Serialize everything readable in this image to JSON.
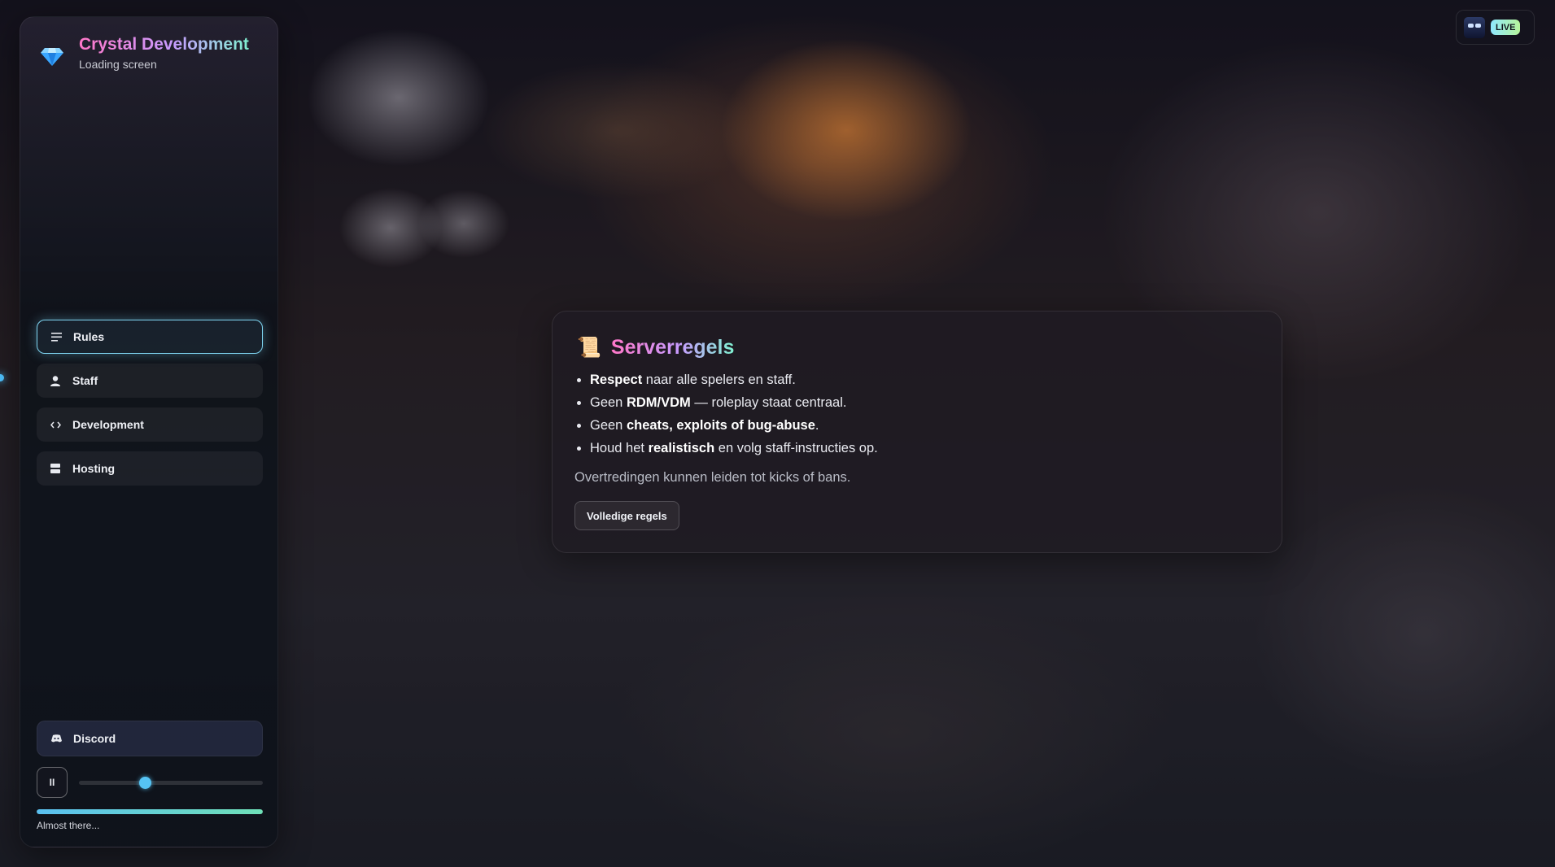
{
  "app": {
    "title": "Crystal Development",
    "subtitle": "Loading screen"
  },
  "sidebar": {
    "nav": [
      {
        "label": "Rules",
        "icon": "list-icon",
        "active": true
      },
      {
        "label": "Staff",
        "icon": "user-icon",
        "active": false
      },
      {
        "label": "Development",
        "icon": "code-icon",
        "active": false
      },
      {
        "label": "Hosting",
        "icon": "server-icon",
        "active": false
      }
    ],
    "discord_label": "Discord",
    "pause_symbol": "II",
    "volume": 0.36,
    "progress": 1.0,
    "status_text": "Almost there..."
  },
  "rules_card": {
    "icon": "📜",
    "title": "Serverregels",
    "items": [
      {
        "pre": "",
        "bold": "Respect",
        "post": " naar alle spelers en staff."
      },
      {
        "pre": "Geen ",
        "bold": "RDM/VDM",
        "post": " — roleplay staat centraal."
      },
      {
        "pre": "Geen ",
        "bold": "cheats, exploits of bug-abuse",
        "post": "."
      },
      {
        "pre": "Houd het ",
        "bold": "realistisch",
        "post": " en volg staff-instructies op."
      }
    ],
    "note": "Overtredingen kunnen leiden tot kicks of bans.",
    "button_label": "Volledige regels"
  },
  "live_badge": {
    "label": "LIVE"
  },
  "colors": {
    "accent_pink": "#ff77c8",
    "accent_mint": "#7ff0d0",
    "active_border": "#7fd6f2",
    "slider": "#56c4f5"
  }
}
